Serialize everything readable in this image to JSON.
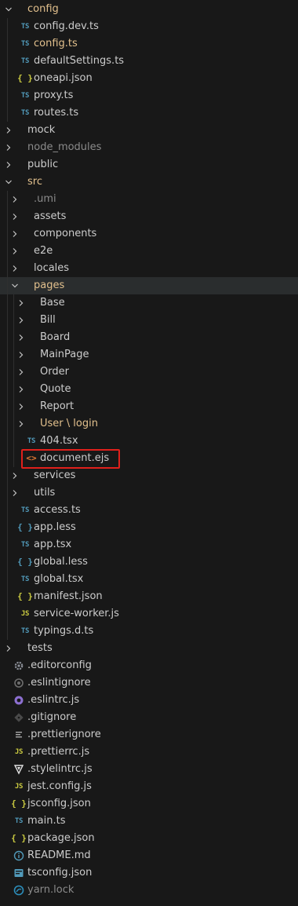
{
  "explorer": {
    "items": [
      {
        "label": "config",
        "kind": "folder",
        "open": true,
        "depth": 0,
        "tone": "accent"
      },
      {
        "label": "config.dev.ts",
        "kind": "file",
        "icon": "ts",
        "depth": 1
      },
      {
        "label": "config.ts",
        "kind": "file",
        "icon": "ts",
        "depth": 1,
        "tone": "accent"
      },
      {
        "label": "defaultSettings.ts",
        "kind": "file",
        "icon": "ts",
        "depth": 1
      },
      {
        "label": "oneapi.json",
        "kind": "file",
        "icon": "json",
        "depth": 1
      },
      {
        "label": "proxy.ts",
        "kind": "file",
        "icon": "ts",
        "depth": 1
      },
      {
        "label": "routes.ts",
        "kind": "file",
        "icon": "ts",
        "depth": 1
      },
      {
        "label": "mock",
        "kind": "folder",
        "open": false,
        "depth": 0
      },
      {
        "label": "node_modules",
        "kind": "folder",
        "open": false,
        "depth": 0,
        "tone": "dim"
      },
      {
        "label": "public",
        "kind": "folder",
        "open": false,
        "depth": 0
      },
      {
        "label": "src",
        "kind": "folder",
        "open": true,
        "depth": 0,
        "tone": "accent"
      },
      {
        "label": ".umi",
        "kind": "folder",
        "open": false,
        "depth": 1,
        "tone": "dim"
      },
      {
        "label": "assets",
        "kind": "folder",
        "open": false,
        "depth": 1
      },
      {
        "label": "components",
        "kind": "folder",
        "open": false,
        "depth": 1
      },
      {
        "label": "e2e",
        "kind": "folder",
        "open": false,
        "depth": 1
      },
      {
        "label": "locales",
        "kind": "folder",
        "open": false,
        "depth": 1
      },
      {
        "label": "pages",
        "kind": "folder",
        "open": true,
        "depth": 1,
        "tone": "accent",
        "selected": true
      },
      {
        "label": "Base",
        "kind": "folder",
        "open": false,
        "depth": 2
      },
      {
        "label": "Bill",
        "kind": "folder",
        "open": false,
        "depth": 2
      },
      {
        "label": "Board",
        "kind": "folder",
        "open": false,
        "depth": 2
      },
      {
        "label": "MainPage",
        "kind": "folder",
        "open": false,
        "depth": 2
      },
      {
        "label": "Order",
        "kind": "folder",
        "open": false,
        "depth": 2
      },
      {
        "label": "Quote",
        "kind": "folder",
        "open": false,
        "depth": 2
      },
      {
        "label": "Report",
        "kind": "folder",
        "open": false,
        "depth": 2
      },
      {
        "label": "User \\ login",
        "kind": "folder",
        "open": false,
        "depth": 2,
        "tone": "accent"
      },
      {
        "label": "404.tsx",
        "kind": "file",
        "icon": "ts",
        "depth": 2
      },
      {
        "label": "document.ejs",
        "kind": "file",
        "icon": "ejs",
        "depth": 2,
        "highlighted": true
      },
      {
        "label": "services",
        "kind": "folder",
        "open": false,
        "depth": 1
      },
      {
        "label": "utils",
        "kind": "folder",
        "open": false,
        "depth": 1
      },
      {
        "label": "access.ts",
        "kind": "file",
        "icon": "ts",
        "depth": 1
      },
      {
        "label": "app.less",
        "kind": "file",
        "icon": "less",
        "depth": 1
      },
      {
        "label": "app.tsx",
        "kind": "file",
        "icon": "ts",
        "depth": 1
      },
      {
        "label": "global.less",
        "kind": "file",
        "icon": "less",
        "depth": 1
      },
      {
        "label": "global.tsx",
        "kind": "file",
        "icon": "ts",
        "depth": 1
      },
      {
        "label": "manifest.json",
        "kind": "file",
        "icon": "json",
        "depth": 1
      },
      {
        "label": "service-worker.js",
        "kind": "file",
        "icon": "js",
        "depth": 1
      },
      {
        "label": "typings.d.ts",
        "kind": "file",
        "icon": "ts",
        "depth": 1
      },
      {
        "label": "tests",
        "kind": "folder",
        "open": false,
        "depth": 0
      },
      {
        "label": ".editorconfig",
        "kind": "file",
        "icon": "gear",
        "depth": 0
      },
      {
        "label": ".eslintignore",
        "kind": "file",
        "icon": "circle",
        "depth": 0
      },
      {
        "label": ".eslintrc.js",
        "kind": "file",
        "icon": "eslint",
        "depth": 0
      },
      {
        "label": ".gitignore",
        "kind": "file",
        "icon": "git",
        "depth": 0
      },
      {
        "label": ".prettierignore",
        "kind": "file",
        "icon": "lines",
        "depth": 0
      },
      {
        "label": ".prettierrc.js",
        "kind": "file",
        "icon": "js",
        "depth": 0
      },
      {
        "label": ".stylelintrc.js",
        "kind": "file",
        "icon": "stylelint",
        "depth": 0
      },
      {
        "label": "jest.config.js",
        "kind": "file",
        "icon": "js",
        "depth": 0
      },
      {
        "label": "jsconfig.json",
        "kind": "file",
        "icon": "json",
        "depth": 0
      },
      {
        "label": "main.ts",
        "kind": "file",
        "icon": "ts",
        "depth": 0
      },
      {
        "label": "package.json",
        "kind": "file",
        "icon": "json",
        "depth": 0
      },
      {
        "label": "README.md",
        "kind": "file",
        "icon": "info",
        "depth": 0
      },
      {
        "label": "tsconfig.json",
        "kind": "file",
        "icon": "tsconfig",
        "depth": 0
      },
      {
        "label": "yarn.lock",
        "kind": "file",
        "icon": "yarn",
        "depth": 0,
        "tone": "dim"
      }
    ]
  },
  "icon_glyphs": {
    "ts": "TS",
    "json": "{ }",
    "less": "{ }",
    "js": "JS",
    "ejs": "<>",
    "folder_open": "chevron-down-icon",
    "folder_closed": "chevron-right-icon"
  },
  "colors": {
    "background": "#181818",
    "text": "#cccccc",
    "accent_text": "#e2c08d",
    "dim_text": "#8b8b8b",
    "ts_blue": "#519aba",
    "json_yellow": "#cbcb41",
    "ejs_orange": "#e37933",
    "highlight_red": "#e0201b"
  }
}
